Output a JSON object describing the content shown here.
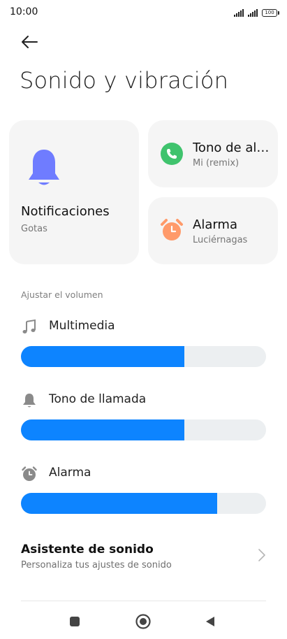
{
  "status": {
    "time": "10:00",
    "battery": "100"
  },
  "header": {
    "title": "Sonido y vibración"
  },
  "cards": {
    "notifications": {
      "title": "Notificaciones",
      "subtitle": "Gotas",
      "icon": "bell-icon",
      "color": "#6f7cff"
    },
    "ringtone": {
      "title": "Tono de alarma",
      "subtitle": "Mi (remix)",
      "icon": "phone-icon",
      "color": "#3fc36d"
    },
    "alarm": {
      "title": "Alarma",
      "subtitle": "Luciérnagas",
      "icon": "alarm-clock-icon",
      "color": "#ff9a6a"
    }
  },
  "volume": {
    "section_label": "Ajustar el volumen",
    "items": [
      {
        "label": "Multimedia",
        "icon": "music-note-icon",
        "level": 0.667
      },
      {
        "label": "Tono de llamada",
        "icon": "bell-icon",
        "level": 0.667
      },
      {
        "label": "Alarma",
        "icon": "alarm-clock-icon",
        "level": 0.8
      }
    ]
  },
  "assistant": {
    "title": "Asistente de sonido",
    "subtitle": "Personaliza tus ajustes de sonido"
  },
  "colors": {
    "accent": "#0d84ff",
    "track": "#eceff1",
    "card_bg": "#f5f5f5"
  }
}
